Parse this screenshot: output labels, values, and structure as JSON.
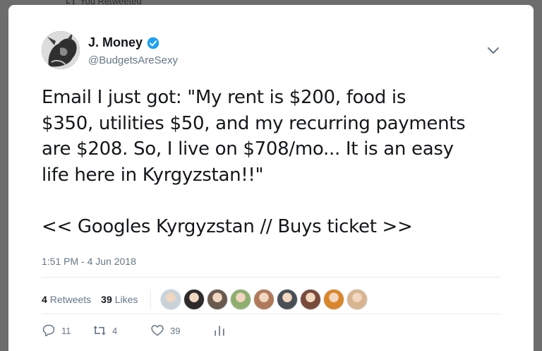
{
  "retweet_bar": {
    "label": "You Retweeted",
    "icon": "retweet-icon"
  },
  "tweet": {
    "author_name": "J. Money",
    "author_handle": "@BudgetsAreSexy",
    "verified": true,
    "text": "Email I just got: \"My rent is $200, food is\n$350, utilities $50, and my recurring payments\nare $208. So, I live on $708/mo... It is an easy\nlife here in Kyrgyzstan!!\"\n\n<< Googles Kyrgyzstan // Buys ticket >>",
    "timestamp": "1:51 PM - 4 Jun 2018"
  },
  "stats": {
    "retweets_count": "4",
    "retweets_label": "Retweets",
    "likes_count": "39",
    "likes_label": "Likes",
    "liker_avatar_colors": [
      "#c9d2d9",
      "#2e2a2a",
      "#6a5a4e",
      "#8fae6f",
      "#b07a5a",
      "#4a4f55",
      "#7a4a3a",
      "#d9862a",
      "#d8b48f"
    ]
  },
  "actions": {
    "reply_count": "11",
    "retweet_count": "4",
    "like_count": "39"
  },
  "colors": {
    "verified": "#1da1f2",
    "text": "#14171a",
    "muted": "#657786",
    "backdrop": "#6d6d6d"
  }
}
